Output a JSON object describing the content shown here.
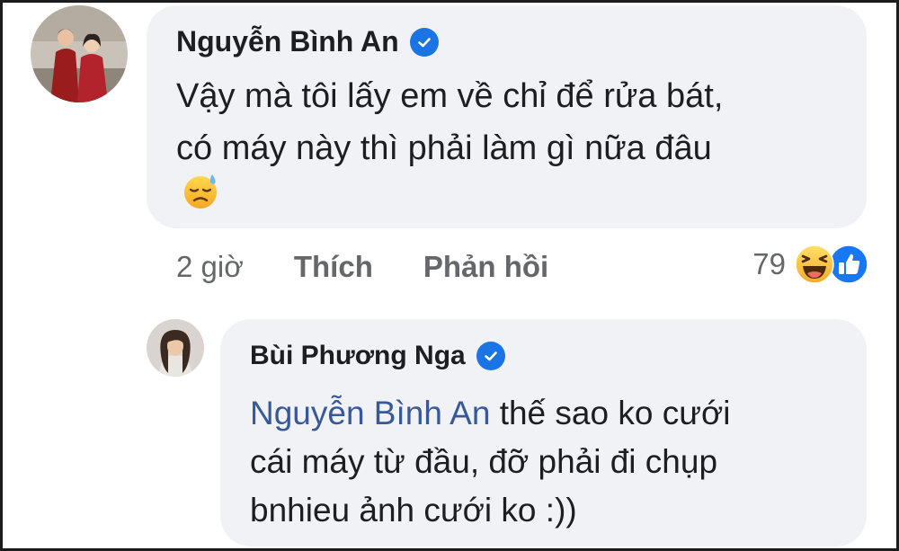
{
  "comment": {
    "author": "Nguyễn Bình An",
    "text_lines": [
      "Vậy mà tôi lấy em về chỉ để rửa bát,",
      "có máy này thì phải làm gì nữa đâu"
    ],
    "emoji": "downcast-face-with-sweat-emoji",
    "time": "2 giờ",
    "like_label": "Thích",
    "reply_label": "Phản hồi",
    "reaction_count": "79",
    "reaction_icons": [
      "haha-reaction-icon",
      "like-reaction-icon"
    ]
  },
  "reply": {
    "author": "Bùi Phương Nga",
    "mention": "Nguyễn Bình An",
    "text_first_rest": " thế sao ko cưới",
    "text_lines": [
      "cái máy từ đầu, đỡ phải đi chụp",
      "bnhieu ảnh cưới ko :))"
    ]
  },
  "colors": {
    "bubble": "#f0f2f5",
    "verified": "#1b74e4",
    "mention": "#385898",
    "meta_text": "#65676b",
    "like_blue": "#1877f2"
  }
}
